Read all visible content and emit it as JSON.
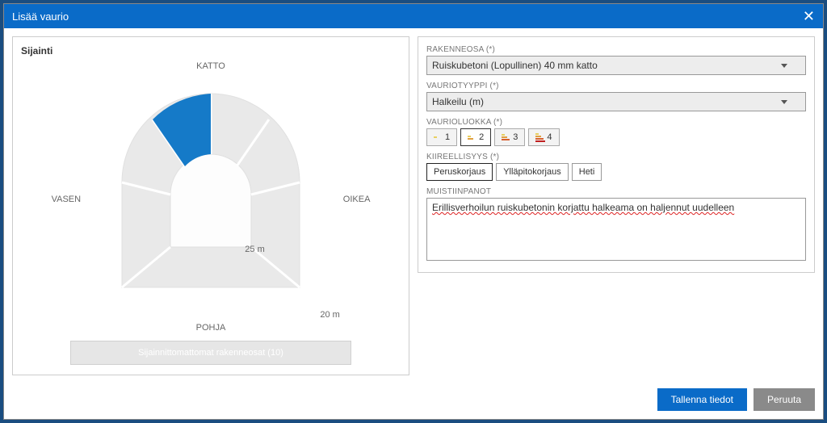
{
  "header": {
    "title": "Lisää vaurio"
  },
  "left": {
    "section_title": "Sijainti",
    "labels": {
      "top": "KATTO",
      "left": "VASEN",
      "right": "OIKEA",
      "bottom": "POHJA"
    },
    "dims": {
      "height": "25 m",
      "width": "20 m"
    },
    "unassigned_button": "Sijainnittomattomat rakenneosat (10)"
  },
  "form": {
    "rakenneosa_label": "RAKENNEOSA (*)",
    "rakenneosa_value": "Ruiskubetoni (Lopullinen) 40 mm katto",
    "vauriotyyppi_label": "VAURIOTYYPPI (*)",
    "vauriotyyppi_value": "Halkeilu (m)",
    "vaurioluokka_label": "VAURIOLUOKKA (*)",
    "classes": [
      "1",
      "2",
      "3",
      "4"
    ],
    "selected_class": "2",
    "kiireellisyys_label": "KIIREELLISYYS (*)",
    "urgency": [
      "Peruskorjaus",
      "Ylläpitokorjaus",
      "Heti"
    ],
    "selected_urgency": "Peruskorjaus",
    "muistiinpanot_label": "MUISTIINPANOT",
    "notes": "Erillisverhoilun ruiskubetonin korjattu halkeama on haljennut uudelleen"
  },
  "footer": {
    "save": "Tallenna tiedot",
    "cancel": "Peruuta"
  }
}
